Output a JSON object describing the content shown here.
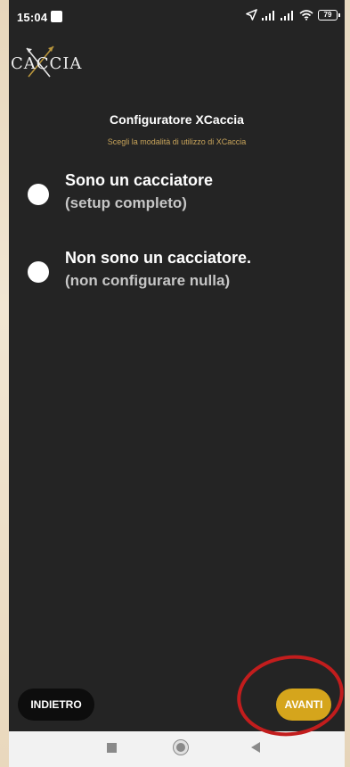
{
  "status_bar": {
    "time": "15:04",
    "battery": "79",
    "icons": [
      "location-arrow-icon",
      "signal-icon",
      "signal-icon",
      "wifi-icon",
      "battery-icon"
    ]
  },
  "logo": {
    "text": "CACCIA"
  },
  "header": {
    "title": "Configuratore XCaccia",
    "subtitle": "Scegli la modalità di utilizzo di XCaccia"
  },
  "options": [
    {
      "main": "Sono un cacciatore",
      "sub": "(setup completo)"
    },
    {
      "main": "Non sono un cacciatore.",
      "sub": "(non configurare nulla)"
    }
  ],
  "buttons": {
    "back": "INDIETRO",
    "next": "AVANTI"
  },
  "colors": {
    "background": "#242424",
    "accent": "#d5a51c",
    "subtitle": "#c8a45a",
    "highlight": "#c21d1d"
  }
}
